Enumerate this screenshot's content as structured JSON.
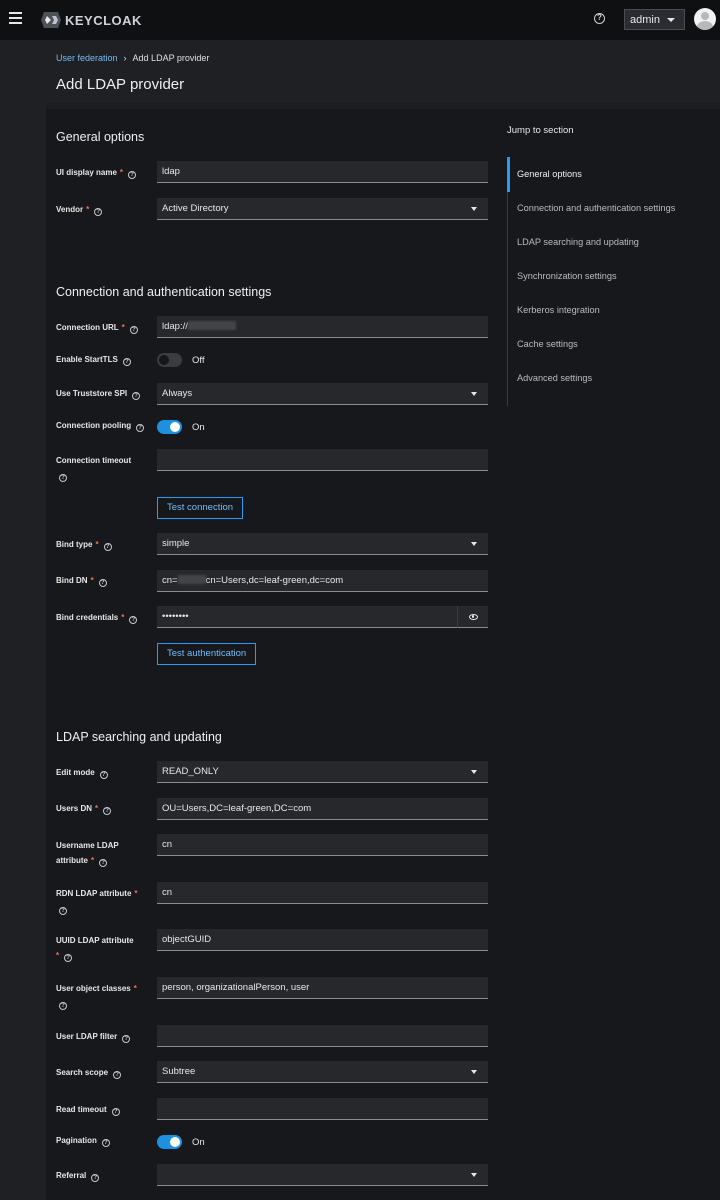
{
  "header": {
    "logo_text": "KEYCLOAK",
    "help_icon": "?",
    "user_menu": "admin"
  },
  "breadcrumb": {
    "parent": "User federation",
    "current": "Add LDAP provider"
  },
  "page_title": "Add LDAP provider",
  "jump": {
    "title": "Jump to section",
    "items": [
      "General options",
      "Connection and authentication settings",
      "LDAP searching and updating",
      "Synchronization settings",
      "Kerberos integration",
      "Cache settings",
      "Advanced settings"
    ],
    "active_index": 0
  },
  "general": {
    "title": "General options",
    "ui_display_name_label": "UI display name",
    "ui_display_name_value": "ldap",
    "vendor_label": "Vendor",
    "vendor_value": "Active Directory"
  },
  "connection": {
    "title": "Connection and authentication settings",
    "connection_url_label": "Connection URL",
    "connection_url_value": "ldap://",
    "starttls_label": "Enable StartTLS",
    "starttls_state": "Off",
    "truststore_label": "Use Truststore SPI",
    "truststore_value": "Always",
    "pooling_label": "Connection pooling",
    "pooling_state": "On",
    "timeout_label": "Connection timeout",
    "timeout_value": "",
    "test_connection": "Test connection",
    "bind_type_label": "Bind type",
    "bind_type_value": "simple",
    "bind_dn_label": "Bind DN",
    "bind_dn_prefix": "cn=",
    "bind_dn_suffix": "cn=Users,dc=leaf-green,dc=com",
    "bind_credentials_label": "Bind credentials",
    "bind_credentials_value": "••••••••",
    "test_authentication": "Test authentication"
  },
  "ldap": {
    "title": "LDAP searching and updating",
    "edit_mode_label": "Edit mode",
    "edit_mode_value": "READ_ONLY",
    "users_dn_label": "Users DN",
    "users_dn_value": "OU=Users,DC=leaf-green,DC=com",
    "username_attr_label": "Username LDAP attribute",
    "username_attr_value": "cn",
    "rdn_attr_label": "RDN LDAP attribute",
    "rdn_attr_value": "cn",
    "uuid_attr_label": "UUID LDAP attribute",
    "uuid_attr_value": "objectGUID",
    "object_classes_label": "User object classes",
    "object_classes_value": "person, organizationalPerson, user",
    "user_filter_label": "User LDAP filter",
    "user_filter_value": "",
    "search_scope_label": "Search scope",
    "search_scope_value": "Subtree",
    "read_timeout_label": "Read timeout",
    "read_timeout_value": "",
    "pagination_label": "Pagination",
    "pagination_state": "On",
    "referral_label": "Referral",
    "referral_value": ""
  },
  "colors": {
    "accent": "#2b9af3",
    "link": "#73bcf7",
    "required": "#f0705a",
    "background": "#17181b"
  }
}
